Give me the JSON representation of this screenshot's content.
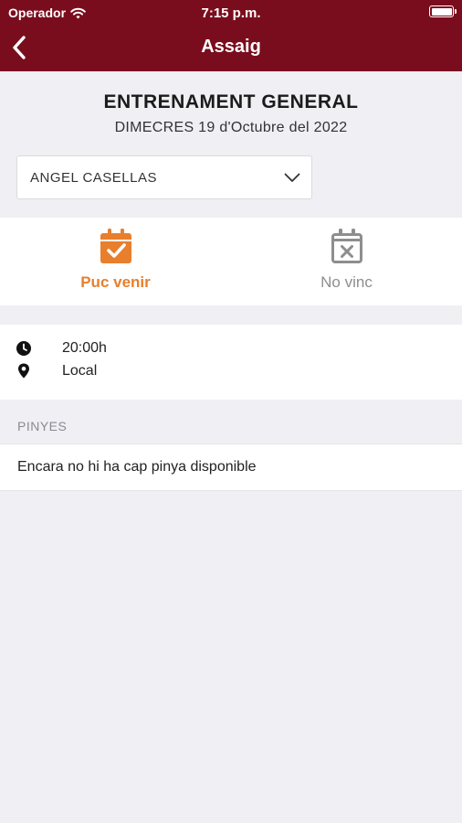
{
  "status_bar": {
    "carrier": "Operador",
    "time": "7:15 p.m."
  },
  "nav": {
    "title": "Assaig",
    "back_icon": "chevron-left-icon"
  },
  "event": {
    "title": "ENTRENAMENT GENERAL",
    "date": "DIMECRES 19 d'Octubre del 2022"
  },
  "member_select": {
    "value": "ANGEL CASELLAS",
    "icon": "chevron-down-icon"
  },
  "attendance": {
    "yes": {
      "label": "Puc venir",
      "icon": "calendar-check-icon",
      "selected": true
    },
    "no": {
      "label": "No vinc",
      "icon": "calendar-x-icon",
      "selected": false
    }
  },
  "details": {
    "time": "20:00h",
    "time_icon": "clock-icon",
    "place": "Local",
    "place_icon": "location-pin-icon"
  },
  "pinyes": {
    "section_label": "PINYES",
    "empty_message": "Encara no hi ha cap pinya disponible"
  },
  "colors": {
    "header": "#7a0d1d",
    "accent": "#e87f2c",
    "inactive": "#8e8e8e",
    "background": "#efeff4"
  }
}
